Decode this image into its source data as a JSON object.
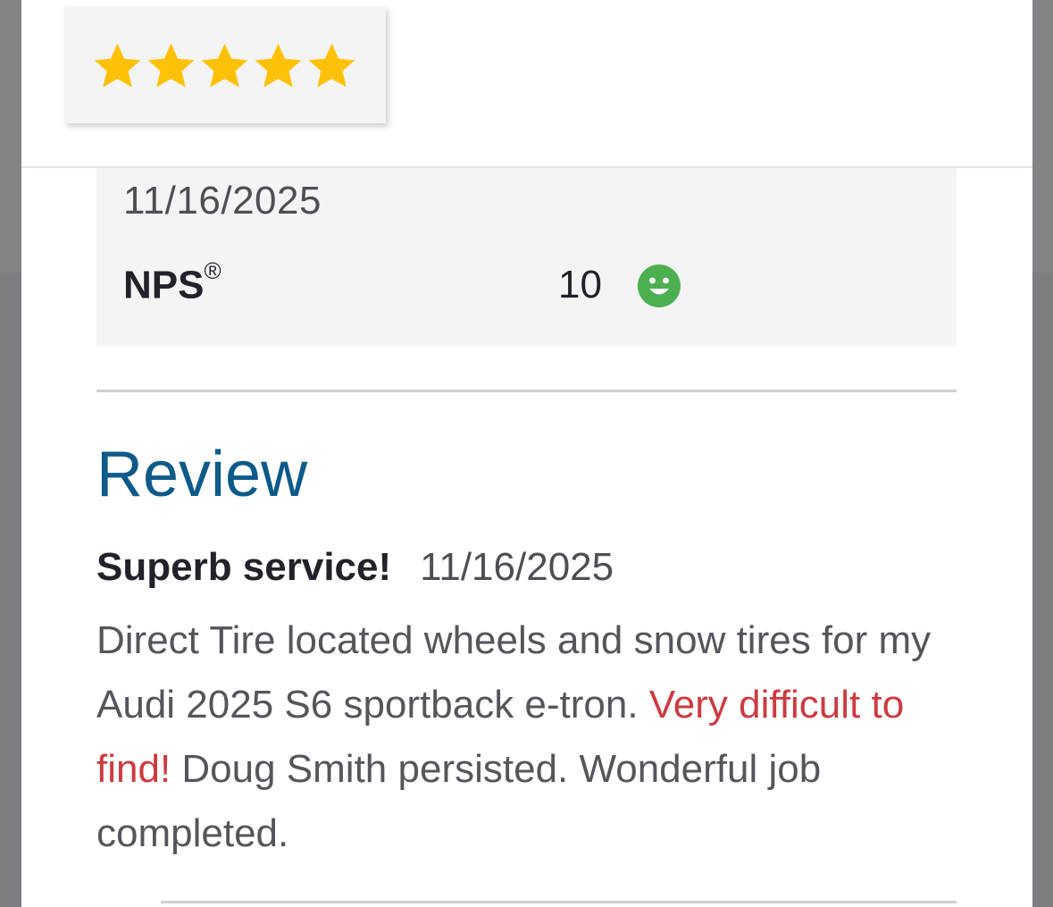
{
  "rating": {
    "stars": 5,
    "max_stars": 5,
    "star_color": "#FFC107"
  },
  "summary": {
    "date": "11/16/2025",
    "nps_label": "NPS",
    "nps_mark": "®",
    "nps_value": "10",
    "sentiment_icon": "smiley-face-icon",
    "sentiment_color": "#4CAF50"
  },
  "review": {
    "heading": "Review",
    "title": "Superb service!",
    "date": "11/16/2025",
    "body_part1": "Direct Tire located wheels and snow tires for my Audi 2025 S6 sportback e-tron. ",
    "body_highlight": "Very difficult to find!",
    "body_part2": " Doug Smith persisted. Wonderful job completed.",
    "heading_color": "#0E5A8A",
    "highlight_color": "#CD3A3F"
  }
}
